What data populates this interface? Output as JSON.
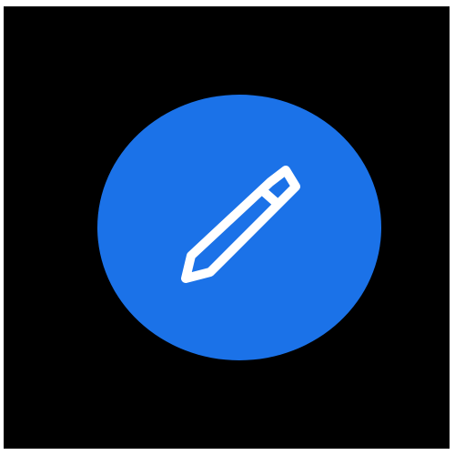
{
  "screen": {
    "background_color": "#000000"
  },
  "edit_button": {
    "icon": "pencil-icon",
    "background_color": "#1b72e8",
    "icon_color": "#ffffff"
  }
}
